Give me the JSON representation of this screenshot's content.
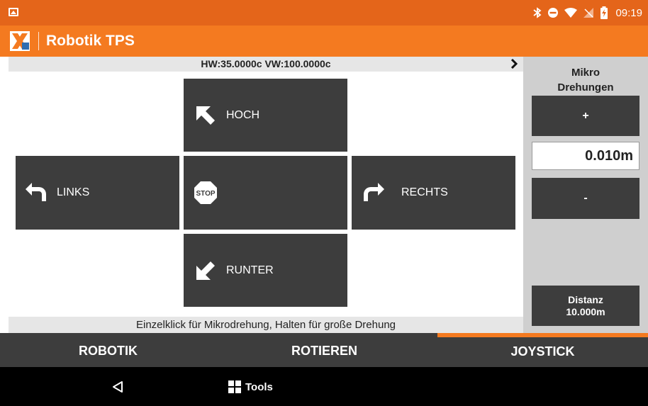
{
  "status_bar": {
    "time": "09:19",
    "icons": [
      "image-icon",
      "bluetooth-icon",
      "do-not-disturb-icon",
      "wifi-icon",
      "no-signal-icon",
      "battery-charging-icon"
    ]
  },
  "app_bar": {
    "title": "Robotik TPS",
    "logo": "app-logo-icon"
  },
  "joystick": {
    "readout": "HW:35.0000c  VW:100.0000c",
    "up_label": "HOCH",
    "left_label": "LINKS",
    "right_label": "RECHTS",
    "down_label": "RUNTER",
    "stop_label": "STOP",
    "hint": "Einzelklick für Mikrodrehung, Halten für große Drehung"
  },
  "side_panel": {
    "title_line1": "Mikro",
    "title_line2": "Drehungen",
    "plus_label": "+",
    "value": "0.010m",
    "minus_label": "-",
    "distance_label": "Distanz",
    "distance_value": "10.000m"
  },
  "tabs": {
    "items": [
      {
        "label": "ROBOTIK"
      },
      {
        "label": "ROTIEREN"
      },
      {
        "label": "JOYSTICK"
      }
    ],
    "active": "JOYSTICK"
  },
  "nav": {
    "tools_label": "Tools"
  },
  "colors": {
    "status_bar": "#e4651a",
    "app_bar": "#f47a20",
    "button": "#3d3d3d",
    "side_panel": "#cfcfcf",
    "accent": "#f47a20"
  }
}
